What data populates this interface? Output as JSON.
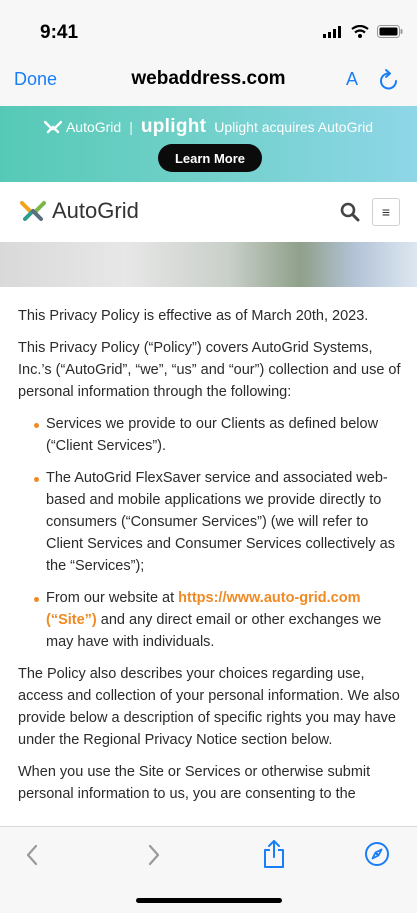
{
  "status": {
    "time": "9:41"
  },
  "browser": {
    "done": "Done",
    "url": "webaddress.com",
    "reader_label": "A"
  },
  "banner": {
    "autogrid": "AutoGrid",
    "separator": "|",
    "brand": "uplight",
    "headline": "Uplight acquires AutoGrid",
    "cta": "Learn More"
  },
  "header": {
    "logo_text": "AutoGrid",
    "menu_glyph": "≡"
  },
  "content": {
    "effective": "This Privacy Policy is effective as of March 20th, 2023.",
    "intro": "This Privacy Policy (“Policy”) covers AutoGrid Systems, Inc.’s (“AutoGrid”, “we”, “us” and “our”) collection and use of personal information through the following:",
    "bullets": [
      "Services we provide to our Clients as defined below (“Client Services”).",
      "The AutoGrid FlexSaver service and associated web-based and mobile applications we provide directly to consumers (“Consumer Services”) (we will refer to Client Services and Consumer Services collectively as the “Services”);"
    ],
    "bullet3_prefix": "From our website at",
    "bullet3_link": "https://www.auto-grid.com (“Site”)",
    "bullet3_suffix": "and any direct email or other exchanges we may have with individuals.",
    "para_choices": "The Policy also describes your choices regarding use, access and collection of your personal information. We also provide below a description of specific rights you may have under the Regional Privacy Notice section below.",
    "para_consent": "When you use the Site or Services or otherwise submit personal information to us, you are consenting to the"
  },
  "icons": {
    "signal": "signal-icon",
    "wifi": "wifi-icon",
    "battery": "battery-icon",
    "reload": "reload-icon",
    "search": "search-icon",
    "menu": "menu-icon",
    "back": "chevron-left-icon",
    "forward": "chevron-right-icon",
    "share": "share-icon",
    "safari": "compass-icon"
  },
  "colors": {
    "accent_blue": "#1a7ef5",
    "brand_orange": "#f08a24",
    "banner_teal": "#56c9b6"
  }
}
